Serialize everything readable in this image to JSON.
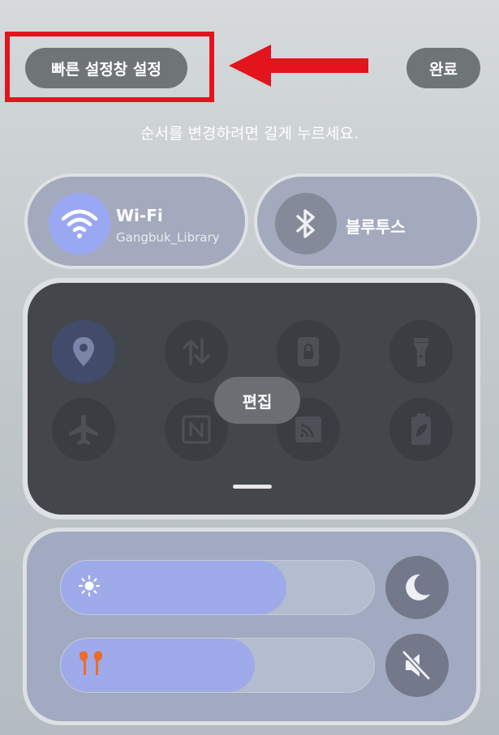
{
  "header": {
    "quick_settings_label": "빠른 설정창 설정",
    "done_label": "완료",
    "hint": "순서를 변경하려면 길게 누르세요."
  },
  "tiles": {
    "wifi": {
      "title": "Wi-Fi",
      "subtitle": "Gangbuk_Library",
      "icon": "wifi-icon"
    },
    "bluetooth": {
      "title": "블루투스",
      "icon": "bluetooth-icon"
    }
  },
  "grid": {
    "edit_label": "편집",
    "icons": [
      "location-icon",
      "data-transfer-icon",
      "screen-lock-icon",
      "flashlight-icon",
      "airplane-icon",
      "nfc-icon",
      "cast-icon",
      "battery-saver-icon"
    ]
  },
  "sliders": {
    "brightness": {
      "icon": "brightness-icon",
      "level": 0.72
    },
    "volume": {
      "icon": "earbuds-icon",
      "level": 0.62
    },
    "dark_mode_icon": "moon-icon",
    "mute_icon": "mute-icon"
  },
  "colors": {
    "annotation": "#e3141c",
    "wifi_active": "#9aa8f3",
    "earbuds": "#ea6d2a"
  }
}
